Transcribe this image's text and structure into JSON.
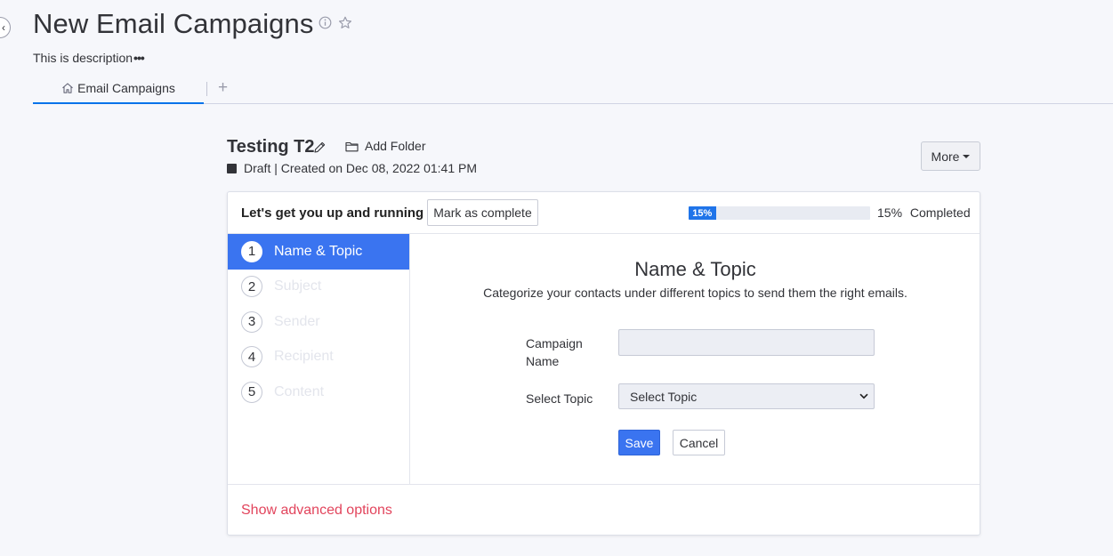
{
  "board": {
    "title": "New Email Campaigns",
    "description": "This is description",
    "description_more": "•••",
    "back_glyph": "‹",
    "icons": [
      "info-icon",
      "star-icon"
    ]
  },
  "tabs": [
    {
      "label": "Email Campaigns",
      "icon": "home-icon",
      "active": true
    }
  ],
  "tab_add_glyph": "+",
  "campaign": {
    "title": "Testing T2",
    "add_folder_label": "Add Folder",
    "status_text": "Draft | Created on Dec 08, 2022 01:41 PM",
    "more_label": "More"
  },
  "wizard": {
    "heading": "Let's get you up and running",
    "mark_complete_label": "Mark as complete",
    "progress": {
      "value": 0.15,
      "bar_label": "15%",
      "text": "15% Completed"
    },
    "steps": [
      {
        "num": "1",
        "label": "Name & Topic",
        "active": true
      },
      {
        "num": "2",
        "label": "Subject",
        "active": false
      },
      {
        "num": "3",
        "label": "Sender",
        "active": false
      },
      {
        "num": "4",
        "label": "Recipient",
        "active": false
      },
      {
        "num": "5",
        "label": "Content",
        "active": false
      }
    ],
    "form": {
      "title": "Name & Topic",
      "subtitle": "Categorize your contacts under different topics to send them the right emails.",
      "campaign_name_label": "Campaign Name",
      "campaign_name_value": "",
      "select_topic_label": "Select Topic",
      "select_topic_value": "Select Topic",
      "save_label": "Save",
      "cancel_label": "Cancel"
    },
    "advanced_link": "Show advanced options"
  },
  "colors": {
    "accent": "#3a74f0",
    "progress": "#1f74e9",
    "link_red": "#e2445c",
    "tab_underline": "#0073ea"
  }
}
